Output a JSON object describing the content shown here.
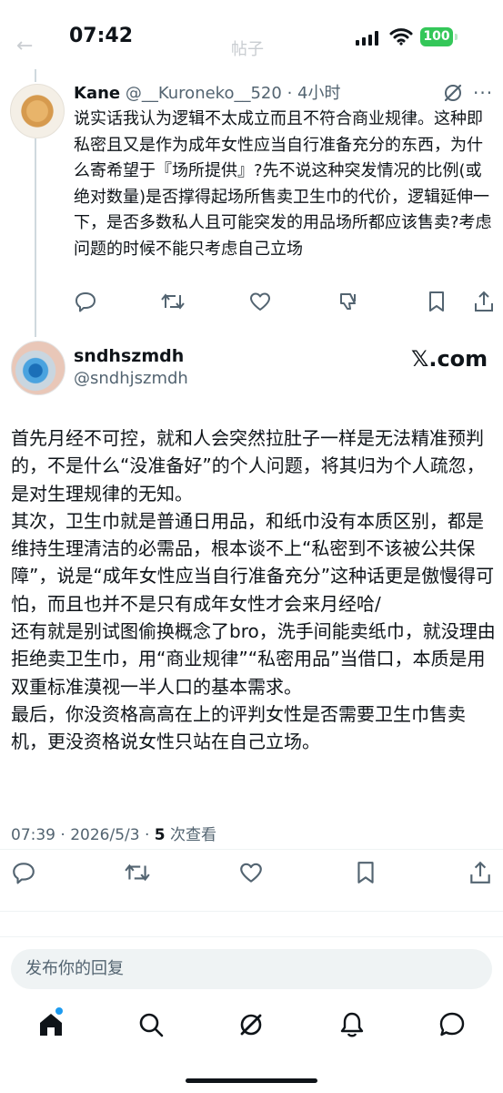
{
  "status_bar": {
    "time": "07:42",
    "battery": "100"
  },
  "header_ghost": {
    "back_glyph": "←",
    "title": "帖子"
  },
  "reply": {
    "author_name": "Kane",
    "author_handle": "@__Kuroneko__520",
    "separator": "·",
    "time_ago": "4小时",
    "text": "说实话我认为逻辑不太成立而且不符合商业规律。这种即私密且又是作为成年女性应当自行准备充分的东西，为什么寄希望于『场所提供』?先不说这种突发情况的比例(或绝对数量)是否撑得起场所售卖卫生巾的代价，逻辑延伸一下，是否多数私人且可能突发的用品场所都应该售卖?考虑问题的时候不能只考虑自己立场",
    "more_glyph": "···"
  },
  "main_post": {
    "author_name": "sndhszmdh",
    "author_handle": "@sndhjszmdh",
    "watermark": "𝕏.com",
    "paragraphs": [
      "首先月经不可控，就和人会突然拉肚子一样是无法精准预判的，不是什么“没准备好”的个人问题，将其归为个人疏忽，是对生理规律的无知。",
      "其次，卫生巾就是普通日用品，和纸巾没有本质区别，都是维持生理清洁的必需品，根本谈不上“私密到不该被公共保障”，说是“成年女性应当自行准备充分”这种话更是傲慢得可怕，而且也并不是只有成年女性才会来月经哈/",
      "还有就是别试图偷换概念了bro，洗手间能卖纸巾，就没理由拒绝卖卫生巾，用“商业规律”“私密用品”当借口，本质是用双重标准漠视一半人口的基本需求。",
      "最后，你没资格高高在上的评判女性是否需要卫生巾售卖机，更没资格说女性只站在自己立场。"
    ],
    "timestamp": "07:39 · 2026/5/3 · ",
    "views_count": "5",
    "views_label": " 次查看"
  },
  "reply_box": {
    "placeholder": "发布你的回复"
  },
  "icons": {
    "reply_actions": [
      "reply-icon",
      "retweet-icon",
      "like-icon",
      "dislike-icon",
      "bookmark-icon",
      "share-icon"
    ],
    "main_actions": [
      "reply-icon",
      "retweet-icon",
      "like-icon",
      "bookmark-icon",
      "share-icon"
    ],
    "bottom_nav": [
      "home-icon",
      "search-icon",
      "grok-icon",
      "notifications-icon",
      "messages-icon"
    ]
  },
  "colors": {
    "text": "#0f1419",
    "secondary": "#536471",
    "accent": "#1d9bf0",
    "battery": "#34c759"
  }
}
